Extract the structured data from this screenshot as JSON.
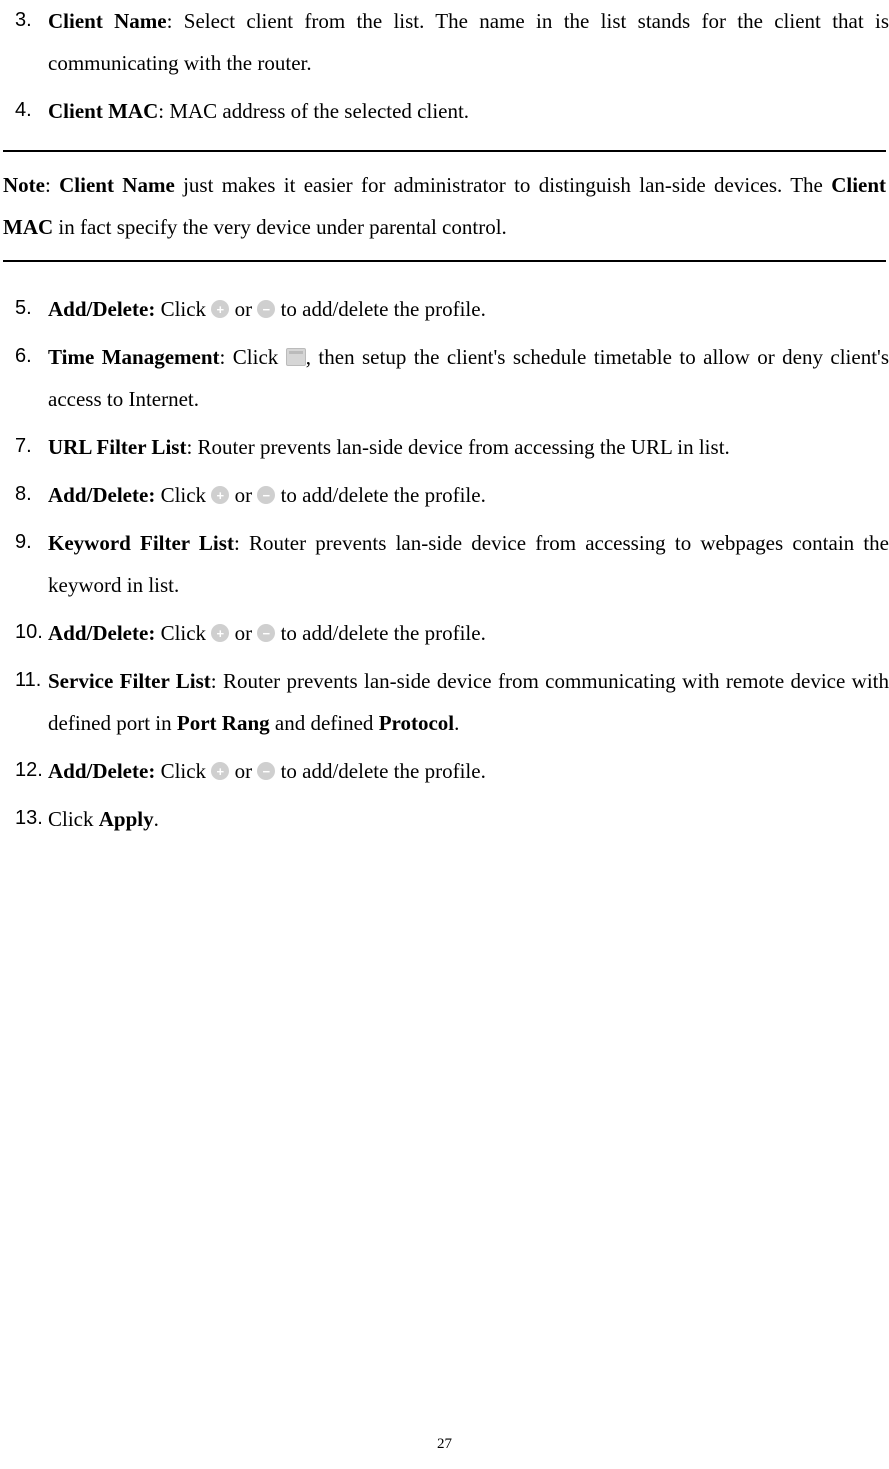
{
  "items": {
    "3": {
      "num": "3.",
      "head": "Client Name",
      "tail": ": Select client from the list. The name in the list stands for the client that is communicating with the router."
    },
    "4": {
      "num": "4.",
      "head": "Client MAC",
      "tail": ": MAC address of the selected client."
    },
    "5": {
      "num": "5.",
      "head": "Add/Delete:",
      "click": " Click ",
      "or": " or ",
      "tail": " to add/delete the profile."
    },
    "6": {
      "num": "6.",
      "head": "Time Management",
      "pre": ": Click ",
      "post": ", then setup the client's schedule timetable to allow or deny client's access to Internet."
    },
    "7": {
      "num": "7.",
      "head": "URL Filter List",
      "tail": ": Router prevents lan-side device from accessing the URL in list."
    },
    "8": {
      "num": "8.",
      "head": "Add/Delete:",
      "click": " Click ",
      "or": " or ",
      "tail": " to add/delete the profile."
    },
    "9": {
      "num": "9.",
      "head": "Keyword Filter List",
      "tail": ": Router prevents lan-side device from accessing to webpages contain the keyword in list."
    },
    "10": {
      "num": "10.",
      "head": "Add/Delete:",
      "click": " Click ",
      "or": " or ",
      "tail": " to add/delete the profile."
    },
    "11": {
      "num": "11.",
      "head": "Service Filter List",
      "pre": ": Router prevents lan-side device from communicating with remote device with defined port in ",
      "b1": "Port Rang",
      "mid": " and defined ",
      "b2": "Protocol",
      "post": "."
    },
    "12": {
      "num": "12.",
      "head": "Add/Delete:",
      "click": " Click ",
      "or": " or ",
      "tail": " to add/delete the profile."
    },
    "13": {
      "num": "13.",
      "pre": "Click ",
      "b": "Apply",
      "post": "."
    }
  },
  "note": {
    "b1": "Note",
    "t1": ": ",
    "b2": "Client Name",
    "t2": " just makes it easier for administrator to distinguish lan-side devices. The ",
    "b3": "Client MAC",
    "t3": " in fact specify the very device under parental control."
  },
  "icons": {
    "plus": "+",
    "minus": "−"
  },
  "page_number": "27"
}
